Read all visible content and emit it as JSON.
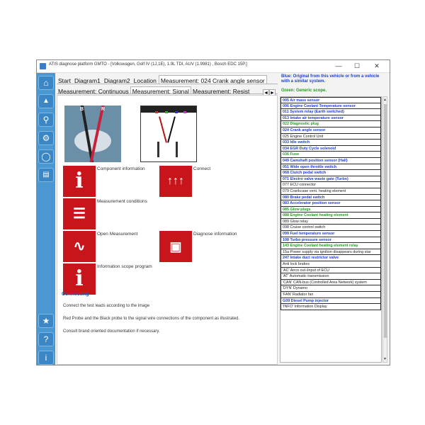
{
  "window": {
    "title": "ATIS diagnose platform GMTO - [Volkswagen, Golf IV (1J,1E), 1.9L TDI, AUV (1.9981) , Bosch EDC 15P.]",
    "minimize": "—",
    "maximize": "☐",
    "close": "✕"
  },
  "tabs_row1": [
    "Start",
    "Diagram1",
    "Diagram2",
    "Location",
    "Measurement: 024 Crank angle sensor"
  ],
  "tabs_row2": [
    "Measurement: Continuous",
    "Measurement: Signal",
    "Measurement: Resist"
  ],
  "tab_arrows": {
    "left": "◄",
    "right": "►"
  },
  "photo_labels": {
    "black": "B",
    "red": "R"
  },
  "actions": {
    "component_information": "Component information",
    "connect": "Connect",
    "measurement_conditions": "Measurement conditions",
    "open_measurement": "Open Measurement",
    "diagnose_information": "Diagnose information",
    "information_scope_program": "Information scope program"
  },
  "info": {
    "title": "Connecting",
    "line1": "Connect the test leads according to the image",
    "line2": "Red Probe and the Black probe to the signal wire connections of the component as illustrated.",
    "line3": "Consult brand oriented documentation if necessary."
  },
  "legend": {
    "blue": "Blue: Original from this vehicle or from a vehicle with a similar system.",
    "green": "Green: Generic scope."
  },
  "colors": {
    "blue": "#1f3fcf",
    "green": "#1c9e1c",
    "black": "#222222",
    "accent_red": "#c8151b",
    "sidebar": "#4a97d2"
  },
  "list": [
    {
      "text": "005 Air mass sensor",
      "color": "blue"
    },
    {
      "text": "006 Engine Coolant Temperature sensor",
      "color": "blue"
    },
    {
      "text": "011 System relay (Earth switched)",
      "color": "blue"
    },
    {
      "text": "013 Intake air temperature sensor",
      "color": "blue"
    },
    {
      "text": "022 Diagnostic plug",
      "color": "green"
    },
    {
      "text": "024 Crank angle sensor",
      "color": "blue"
    },
    {
      "text": "025 Engine Control Unit",
      "color": "black"
    },
    {
      "text": "033 Idle switch",
      "color": "blue"
    },
    {
      "text": "034 EGR Duty Cycle solenoid",
      "color": "blue"
    },
    {
      "text": "036 Fuse",
      "color": "green"
    },
    {
      "text": "049 Camshaft position sensor (Hall)",
      "color": "blue"
    },
    {
      "text": "051 Wide open throttle switch",
      "color": "blue"
    },
    {
      "text": "068 Clutch pedal switch",
      "color": "blue"
    },
    {
      "text": "071 Electro valve waste gate (Turbo)",
      "color": "blue"
    },
    {
      "text": "077 ECU connector",
      "color": "black"
    },
    {
      "text": "079 Crankcase vent. heating element",
      "color": "black"
    },
    {
      "text": "080 Brake pedal switch",
      "color": "blue"
    },
    {
      "text": "083 Accelerator position sensor",
      "color": "blue"
    },
    {
      "text": "085 Glow plugs",
      "color": "green"
    },
    {
      "text": "088 Engine Coolant heating element",
      "color": "green"
    },
    {
      "text": "089 Glow relay",
      "color": "black"
    },
    {
      "text": "098 Cruise control switch",
      "color": "black"
    },
    {
      "text": "099 Fuel temperature sensor",
      "color": "blue"
    },
    {
      "text": "108 Turbo pressure sensor",
      "color": "blue"
    },
    {
      "text": "143 Engine Coolant heating element relay",
      "color": "green"
    },
    {
      "text": "15a Power supply via ignition disappears during star",
      "color": "black"
    },
    {
      "text": "247 Intake duct restrictor valve",
      "color": "blue"
    },
    {
      "text": "Anti lock brakes",
      "color": "black"
    },
    {
      "text": "'AC' Airco out-/input of ECU",
      "color": "black"
    },
    {
      "text": "'AT' Automatic transmission",
      "color": "black"
    },
    {
      "text": "'CAN' CAN-bus (Controlled Area Network) system",
      "color": "black"
    },
    {
      "text": "'DYN' Dynamo",
      "color": "black"
    },
    {
      "text": "'FAN' Radiator fan",
      "color": "black"
    },
    {
      "text": "G09 Diesel Pump injector",
      "color": "blue"
    },
    {
      "text": "'INFO' Information Display",
      "color": "black"
    }
  ],
  "sidebar_icons": [
    "home-icon",
    "car-icon",
    "search-icon",
    "gear-icon",
    "chat-icon",
    "vehicle-list-icon",
    "star-icon",
    "help-icon",
    "info-icon"
  ]
}
